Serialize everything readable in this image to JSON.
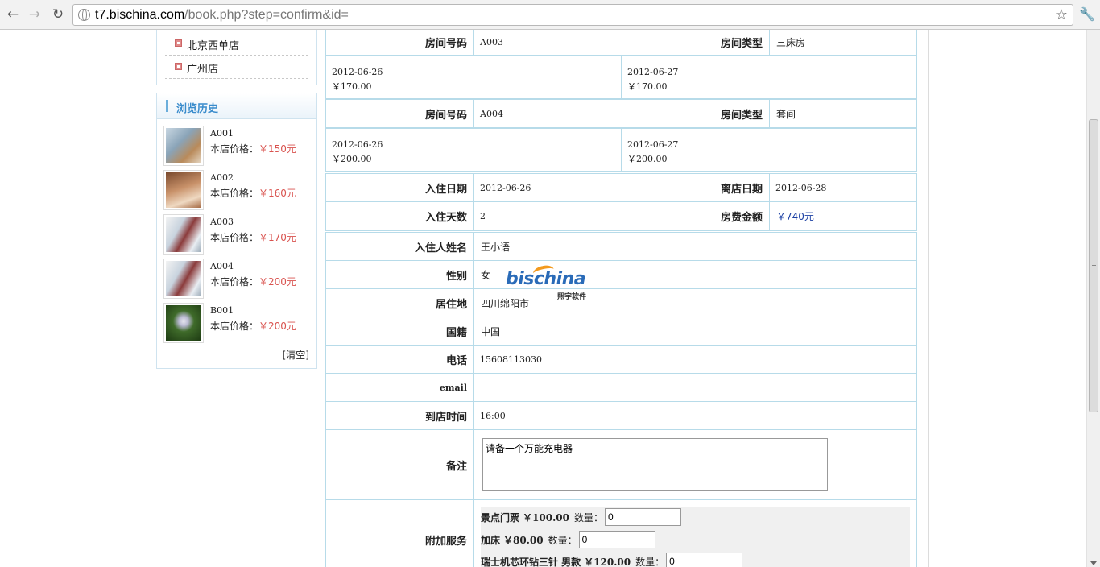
{
  "browser": {
    "url_host": "t7.bischina.com",
    "url_path": "/book.php?step=confirm&id="
  },
  "stores": [
    "北京西单店",
    "广州店"
  ],
  "history": {
    "title": "浏览历史",
    "price_label": "本店价格：",
    "items": [
      {
        "code": "A001",
        "price": "￥150元"
      },
      {
        "code": "A002",
        "price": "￥160元"
      },
      {
        "code": "A003",
        "price": "￥170元"
      },
      {
        "code": "A004",
        "price": "￥200元"
      },
      {
        "code": "B001",
        "price": "￥200元"
      }
    ],
    "clear": "[清空]"
  },
  "rooms": [
    {
      "number_label": "房间号码",
      "number": "A003",
      "type_label": "房间类型",
      "type": "三床房",
      "day1_date": "2012-06-26",
      "day1_price": "￥170.00",
      "day2_date": "2012-06-27",
      "day2_price": "￥170.00"
    },
    {
      "number_label": "房间号码",
      "number": "A004",
      "type_label": "房间类型",
      "type": "套间",
      "day1_date": "2012-06-26",
      "day1_price": "￥200.00",
      "day2_date": "2012-06-27",
      "day2_price": "￥200.00"
    }
  ],
  "stay": {
    "checkin_label": "入住日期",
    "checkin": "2012-06-26",
    "checkout_label": "离店日期",
    "checkout": "2012-06-28",
    "days_label": "入住天数",
    "days": "2",
    "total_label": "房费金额",
    "total": "￥740元"
  },
  "guest": {
    "name_label": "入住人姓名",
    "name": "王小语",
    "gender_label": "性别",
    "gender": "女",
    "address_label": "居住地",
    "address": "四川绵阳市",
    "nationality_label": "国籍",
    "nationality": "中国",
    "phone_label": "电话",
    "phone": "15608113030",
    "email_label": "email",
    "email": "",
    "arrival_label": "到店时间",
    "arrival": "16:00",
    "remark_label": "备注",
    "remark": "请备一个万能充电器"
  },
  "services": {
    "label": "附加服务",
    "qty_label": "数量：",
    "items": [
      {
        "name": "景点门票",
        "price": "￥100.00",
        "qty": "0"
      },
      {
        "name": "加床",
        "price": "￥80.00",
        "qty": "0"
      },
      {
        "name": "瑞士机芯环钻三针 男款",
        "price": "￥120.00",
        "qty": "0"
      }
    ]
  },
  "watermark": {
    "word": "bischina",
    "sub": "熙宇软件"
  }
}
